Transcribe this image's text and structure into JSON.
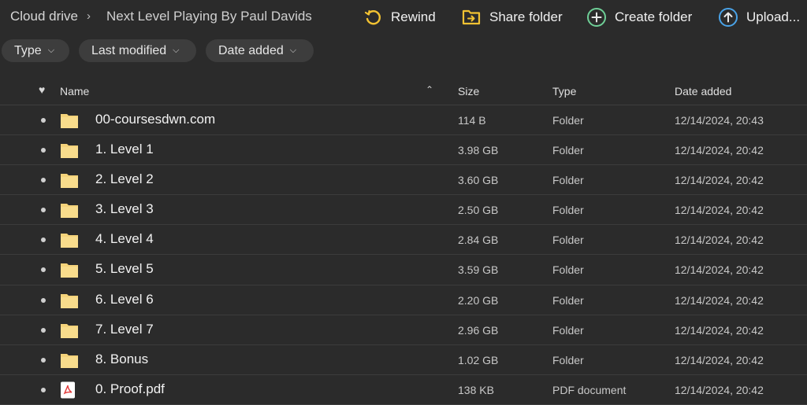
{
  "breadcrumb": {
    "root": "Cloud drive",
    "separator": "›",
    "current": "Next Level Playing By Paul Davids"
  },
  "actions": {
    "rewind": "Rewind",
    "share_folder": "Share folder",
    "create_folder": "Create folder",
    "upload": "Upload..."
  },
  "filters": {
    "type": "Type",
    "last_modified": "Last modified",
    "date_added": "Date added"
  },
  "columns": {
    "favourite_icon": "heart-icon",
    "name": "Name",
    "size": "Size",
    "type": "Type",
    "date_added": "Date added"
  },
  "files": [
    {
      "name": "00-coursesdwn.com",
      "size": "114 B",
      "type": "Folder",
      "date": "12/14/2024, 20:43",
      "icon": "folder"
    },
    {
      "name": "1. Level 1",
      "size": "3.98 GB",
      "type": "Folder",
      "date": "12/14/2024, 20:42",
      "icon": "folder"
    },
    {
      "name": "2. Level 2",
      "size": "3.60 GB",
      "type": "Folder",
      "date": "12/14/2024, 20:42",
      "icon": "folder"
    },
    {
      "name": "3. Level 3",
      "size": "2.50 GB",
      "type": "Folder",
      "date": "12/14/2024, 20:42",
      "icon": "folder"
    },
    {
      "name": "4. Level 4",
      "size": "2.84 GB",
      "type": "Folder",
      "date": "12/14/2024, 20:42",
      "icon": "folder"
    },
    {
      "name": "5. Level 5",
      "size": "3.59 GB",
      "type": "Folder",
      "date": "12/14/2024, 20:42",
      "icon": "folder"
    },
    {
      "name": "6. Level 6",
      "size": "2.20 GB",
      "type": "Folder",
      "date": "12/14/2024, 20:42",
      "icon": "folder"
    },
    {
      "name": "7. Level 7",
      "size": "2.96 GB",
      "type": "Folder",
      "date": "12/14/2024, 20:42",
      "icon": "folder"
    },
    {
      "name": "8. Bonus",
      "size": "1.02 GB",
      "type": "Folder",
      "date": "12/14/2024, 20:42",
      "icon": "folder"
    },
    {
      "name": "0. Proof.pdf",
      "size": "138 KB",
      "type": "PDF document",
      "date": "12/14/2024, 20:42",
      "icon": "pdf"
    }
  ],
  "colors": {
    "background": "#2b2b2b",
    "folder": "#f5d37a",
    "rewind_accent": "#f2c232",
    "share_accent": "#f2c232",
    "create_accent": "#6fcf97",
    "upload_accent": "#4aa3e8",
    "pdf_accent": "#e23b3b"
  }
}
